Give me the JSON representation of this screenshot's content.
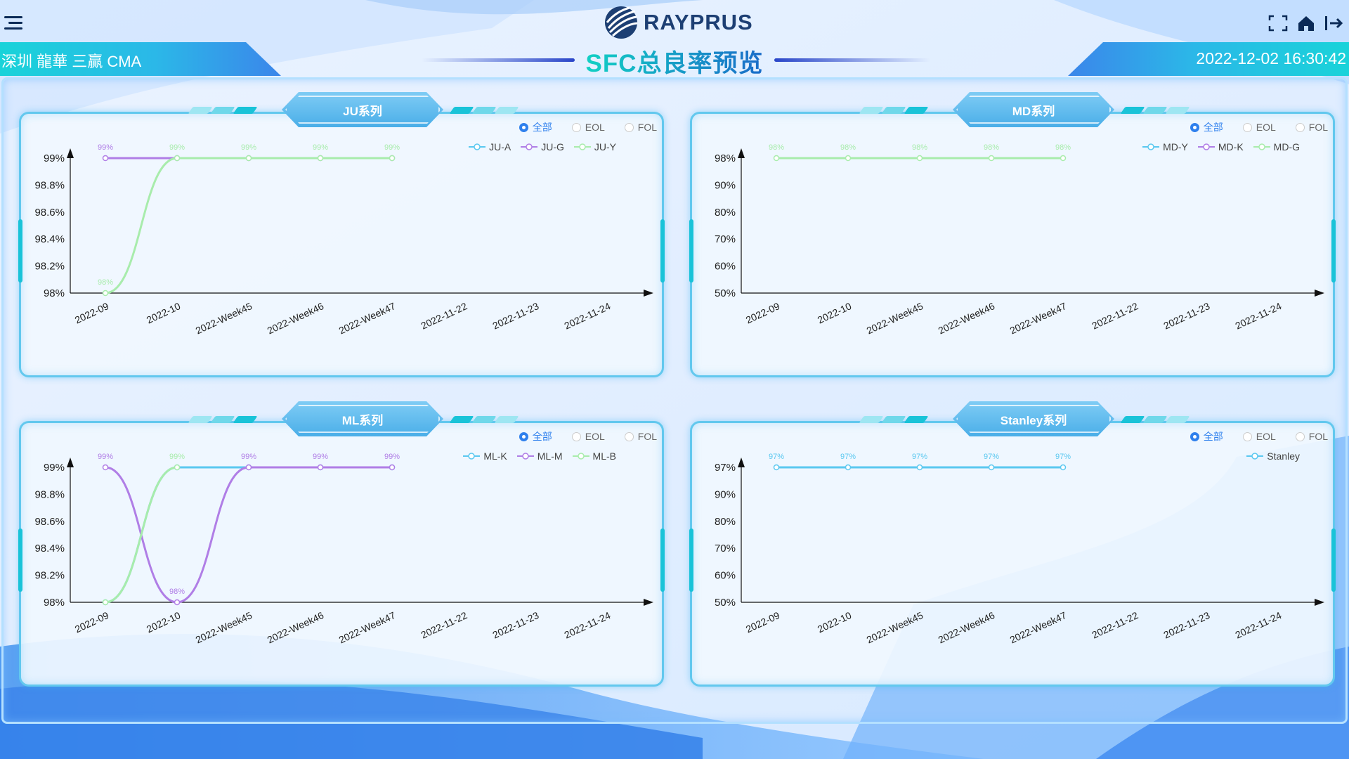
{
  "header": {
    "brand": "RAYPRUS",
    "title": "SFC总良率预览",
    "location": "深圳 龍華 三贏 CMA",
    "datetime": "2022-12-02 16:30:42"
  },
  "icons": {
    "menu": "menu-icon",
    "fullscreen": "fullscreen-icon",
    "home": "home-icon",
    "logout": "logout-icon"
  },
  "filters": [
    "全部",
    "EOL",
    "FOL"
  ],
  "x_categories": [
    "2022-09",
    "2022-10",
    "2022-Week45",
    "2022-Week46",
    "2022-Week47",
    "2022-11-22",
    "2022-11-23",
    "2022-11-24"
  ],
  "colors": {
    "cyan": "#5ac8f0",
    "purple": "#b07ee6",
    "green": "#a8ecac",
    "accent": "#2f80ed"
  },
  "panels": [
    {
      "title": "JU系列",
      "selected_filter": "全部",
      "chart_data": {
        "type": "line",
        "categories": [
          "2022-09",
          "2022-10",
          "2022-Week45",
          "2022-Week46",
          "2022-Week47",
          "2022-11-22",
          "2022-11-23",
          "2022-11-24"
        ],
        "y_ticks": [
          "98%",
          "98.2%",
          "98.4%",
          "98.6%",
          "98.8%",
          "99%"
        ],
        "ylim": [
          98,
          99
        ],
        "series": [
          {
            "name": "JU-A",
            "color": "#5ac8f0",
            "values": []
          },
          {
            "name": "JU-G",
            "color": "#b07ee6",
            "values": [
              99,
              99,
              99,
              99,
              99
            ]
          },
          {
            "name": "JU-Y",
            "color": "#a8ecac",
            "values": [
              98,
              99,
              99,
              99,
              99
            ]
          }
        ],
        "data_labels": [
          {
            "series": 1,
            "index": 0,
            "text": "99%"
          },
          {
            "series": 2,
            "index": 0,
            "text": "98%"
          },
          {
            "series": 2,
            "index": 1,
            "text": "99%"
          },
          {
            "series": 2,
            "index": 2,
            "text": "99%"
          },
          {
            "series": 2,
            "index": 3,
            "text": "99%"
          },
          {
            "series": 2,
            "index": 4,
            "text": "99%"
          }
        ]
      }
    },
    {
      "title": "MD系列",
      "selected_filter": "全部",
      "chart_data": {
        "type": "line",
        "categories": [
          "2022-09",
          "2022-10",
          "2022-Week45",
          "2022-Week46",
          "2022-Week47",
          "2022-11-22",
          "2022-11-23",
          "2022-11-24"
        ],
        "y_ticks": [
          "50%",
          "60%",
          "70%",
          "80%",
          "90%",
          "98%"
        ],
        "ylim": [
          50,
          98
        ],
        "series": [
          {
            "name": "MD-Y",
            "color": "#5ac8f0",
            "values": []
          },
          {
            "name": "MD-K",
            "color": "#b07ee6",
            "values": []
          },
          {
            "name": "MD-G",
            "color": "#a8ecac",
            "values": [
              98,
              98,
              98,
              98,
              98
            ]
          }
        ],
        "data_labels": [
          {
            "series": 2,
            "index": 0,
            "text": "98%"
          },
          {
            "series": 2,
            "index": 1,
            "text": "98%"
          },
          {
            "series": 2,
            "index": 2,
            "text": "98%"
          },
          {
            "series": 2,
            "index": 3,
            "text": "98%"
          },
          {
            "series": 2,
            "index": 4,
            "text": "98%"
          }
        ]
      }
    },
    {
      "title": "ML系列",
      "selected_filter": "全部",
      "chart_data": {
        "type": "line",
        "categories": [
          "2022-09",
          "2022-10",
          "2022-Week45",
          "2022-Week46",
          "2022-Week47",
          "2022-11-22",
          "2022-11-23",
          "2022-11-24"
        ],
        "y_ticks": [
          "98%",
          "98.2%",
          "98.4%",
          "98.6%",
          "98.8%",
          "99%"
        ],
        "ylim": [
          98,
          99
        ],
        "series": [
          {
            "name": "ML-K",
            "color": "#5ac8f0",
            "values": [
              98,
              99,
              99,
              99,
              99
            ]
          },
          {
            "name": "ML-M",
            "color": "#b07ee6",
            "values": [
              99,
              98,
              99,
              99,
              99
            ]
          },
          {
            "name": "ML-B",
            "color": "#a8ecac",
            "values": [
              98,
              99
            ]
          }
        ],
        "data_labels": [
          {
            "series": 1,
            "index": 0,
            "text": "99%"
          },
          {
            "series": 2,
            "index": 1,
            "text": "99%"
          },
          {
            "series": 1,
            "index": 1,
            "text": "98%"
          },
          {
            "series": 1,
            "index": 2,
            "text": "99%"
          },
          {
            "series": 1,
            "index": 3,
            "text": "99%"
          },
          {
            "series": 1,
            "index": 4,
            "text": "99%"
          }
        ]
      }
    },
    {
      "title": "Stanley系列",
      "selected_filter": "全部",
      "chart_data": {
        "type": "line",
        "categories": [
          "2022-09",
          "2022-10",
          "2022-Week45",
          "2022-Week46",
          "2022-Week47",
          "2022-11-22",
          "2022-11-23",
          "2022-11-24"
        ],
        "y_ticks": [
          "50%",
          "60%",
          "70%",
          "80%",
          "90%",
          "97%"
        ],
        "ylim": [
          50,
          97
        ],
        "series": [
          {
            "name": "Stanley",
            "color": "#5ac8f0",
            "values": [
              97,
              97,
              97,
              97,
              97
            ]
          }
        ],
        "data_labels": [
          {
            "series": 0,
            "index": 0,
            "text": "97%"
          },
          {
            "series": 0,
            "index": 1,
            "text": "97%"
          },
          {
            "series": 0,
            "index": 2,
            "text": "97%"
          },
          {
            "series": 0,
            "index": 3,
            "text": "97%"
          },
          {
            "series": 0,
            "index": 4,
            "text": "97%"
          }
        ]
      }
    }
  ]
}
